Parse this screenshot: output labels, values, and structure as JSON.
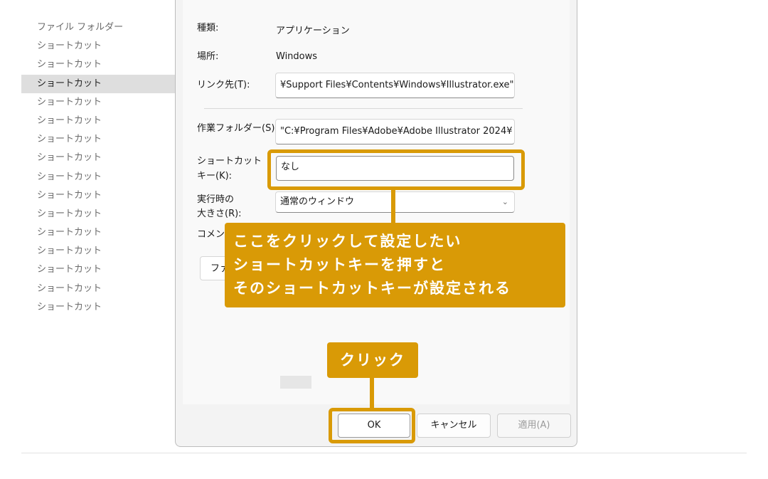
{
  "sidebar": {
    "items": [
      {
        "label": "ファイル フォルダー",
        "selected": false
      },
      {
        "label": "ショートカット",
        "selected": false
      },
      {
        "label": "ショートカット",
        "selected": false
      },
      {
        "label": "ショートカット",
        "selected": true
      },
      {
        "label": "ショートカット",
        "selected": false
      },
      {
        "label": "ショートカット",
        "selected": false
      },
      {
        "label": "ショートカット",
        "selected": false
      },
      {
        "label": "ショートカット",
        "selected": false
      },
      {
        "label": "ショートカット",
        "selected": false
      },
      {
        "label": "ショートカット",
        "selected": false
      },
      {
        "label": "ショートカット",
        "selected": false
      },
      {
        "label": "ショートカット",
        "selected": false
      },
      {
        "label": "ショートカット",
        "selected": false
      },
      {
        "label": "ショートカット",
        "selected": false
      },
      {
        "label": "ショートカット",
        "selected": false
      },
      {
        "label": "ショートカット",
        "selected": false
      }
    ]
  },
  "dialog": {
    "type_label": "種類:",
    "type_value": "アプリケーション",
    "location_label": "場所:",
    "location_value": "Windows",
    "target_label": "リンク先(T):",
    "target_value": "¥Support Files¥Contents¥Windows¥Illustrator.exe\"",
    "workdir_label": "作業フォルダー(S):",
    "workdir_value": "\"C:¥Program Files¥Adobe¥Adobe Illustrator 2024¥",
    "shortcut_label_1": "ショートカット",
    "shortcut_label_2": "キー(K):",
    "shortcut_value": "なし",
    "run_label_1": "実行時の",
    "run_label_2": "大きさ(R):",
    "run_value": "通常のウィンドウ",
    "comment_label": "コメント",
    "file_button_partial": "ファ",
    "ok_label": "OK",
    "cancel_label": "キャンセル",
    "apply_label": "適用(A)"
  },
  "annotations": {
    "callout_lines": [
      "ここをクリックして設定したい",
      "ショートカットキーを押すと",
      "そのショートカットキーが設定される"
    ],
    "click_label": "クリック",
    "accent_color": "#d99a06"
  }
}
